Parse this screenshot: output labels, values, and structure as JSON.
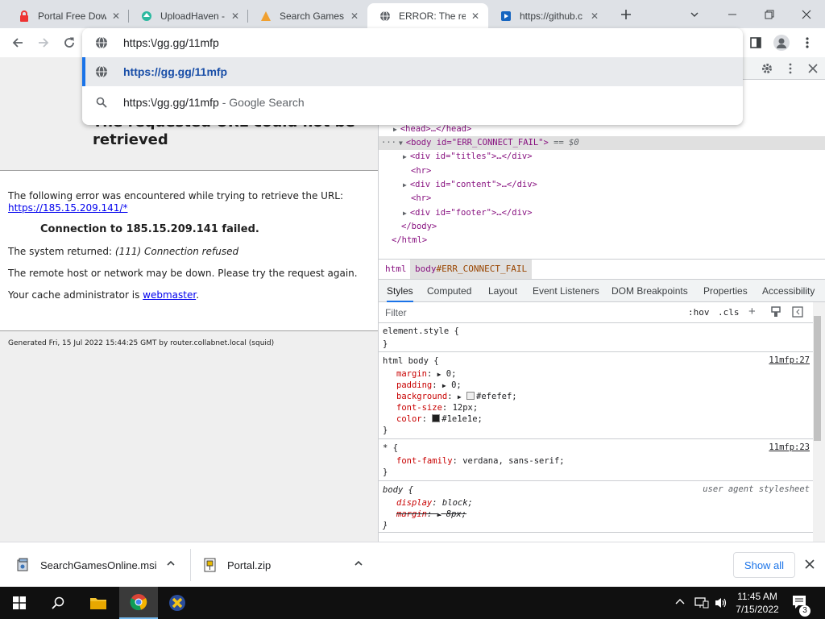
{
  "tabs": [
    {
      "title": "Portal Free Dow",
      "icon": "red-lock-icon"
    },
    {
      "title": "UploadHaven -",
      "icon": "uploadhaven-icon"
    },
    {
      "title": "Search Games O",
      "icon": "game-icon"
    },
    {
      "title": "ERROR: The req",
      "icon": "globe-icon",
      "active": true
    },
    {
      "title": "https://github.c",
      "icon": "github-icon"
    }
  ],
  "omnibox": {
    "input_value": "https:\\/gg.gg/11mfp",
    "suggestion_url": "https://gg.gg/11mfp",
    "suggestion_search": "https:\\/gg.gg/11mfp",
    "suggestion_search_suffix": "- Google Search"
  },
  "page": {
    "title": "The requested URL could not be retrieved",
    "intro": "The following error was encountered while trying to retrieve the URL:",
    "url_link": "https://185.15.209.141/*",
    "error_prefix": "Connection to ",
    "error_host": "185.15.209.141",
    "error_suffix": " failed.",
    "system_label": "The system returned: ",
    "system_value": "(111) Connection refused",
    "hint": "The remote host or network may be down. Please try the request again.",
    "admin_prefix": "Your cache administrator is ",
    "admin_link": "webmaster",
    "admin_suffix": ".",
    "footer": "Generated Fri, 15 Jul 2022 15:44:25 GMT by router.collabnet.local (squid)"
  },
  "devtools": {
    "elements": {
      "head": "<head>…</head>",
      "body_open": "<body id=\"ERR_CONNECT_FAIL\">",
      "body_marker": "== $0",
      "div_titles": "<div id=\"titles\">…</div>",
      "hr1": "<hr>",
      "div_content": "<div id=\"content\">…</div>",
      "hr2": "<hr>",
      "div_footer": "<div id=\"footer\">…</div>",
      "body_close": "</body>",
      "html_close": "</html>"
    },
    "breadcrumbs": {
      "html": "html",
      "body_tag": "body",
      "body_id": "#ERR_CONNECT_FAIL"
    },
    "subtabs": [
      "Styles",
      "Computed",
      "Layout",
      "Event Listeners",
      "DOM Breakpoints",
      "Properties",
      "Accessibility"
    ],
    "filter_placeholder": "Filter",
    "hov": ":hov",
    ".cls": ".cls",
    "rules": {
      "element_style": "element.style {",
      "close": "}",
      "html_body": {
        "selector": "html body {",
        "source": "11mfp:27",
        "margin": "0;",
        "padding": "0;",
        "background": "#efefef;",
        "background_color": "#efefef",
        "font_size": "12px;",
        "color": "#1e1e1e;",
        "color_value": "#1e1e1e"
      },
      "star": {
        "selector": "* {",
        "source": "11mfp:23",
        "font_family": "verdana, sans-serif;"
      },
      "body_ua": {
        "selector": "body {",
        "source": "user agent stylesheet",
        "display": "block;",
        "margin": "8px;"
      }
    },
    "prop_names": {
      "margin": "margin",
      "padding": "padding",
      "background": "background",
      "font_size": "font-size",
      "color": "color",
      "font_family": "font-family",
      "display": "display"
    }
  },
  "downloads": [
    {
      "name": "SearchGamesOnline.msi",
      "icon": "msi-installer-icon"
    },
    {
      "name": "Portal.zip",
      "icon": "zip-archive-icon"
    }
  ],
  "show_all": "Show all",
  "taskbar": {
    "time": "11:45 AM",
    "date": "7/15/2022",
    "notifications": "3"
  }
}
